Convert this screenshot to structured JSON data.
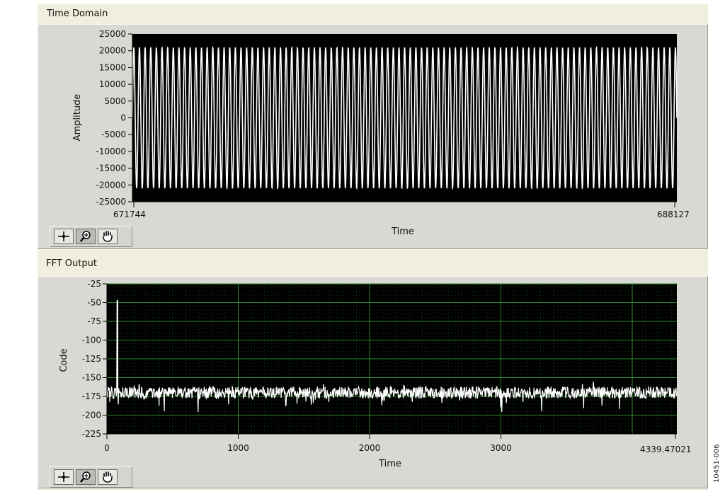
{
  "time_domain": {
    "title": "Time Domain",
    "xlabel": "Time",
    "ylabel": "Amplitude",
    "x_start_label": "671744",
    "x_end_label": "688127",
    "colors": {
      "plot_bg": "#000000",
      "trace": "#ffffff"
    },
    "y_ticks": [
      "25000",
      "20000",
      "15000",
      "10000",
      "5000",
      "0",
      "-5000",
      "-10000",
      "-15000",
      "-20000",
      "-25000"
    ]
  },
  "fft_output": {
    "title": "FFT Output",
    "xlabel": "Time",
    "ylabel": "Code",
    "x_ticks": [
      "0",
      "1000",
      "2000",
      "3000"
    ],
    "x_end_label": "4339.47021",
    "colors": {
      "plot_bg": "#000000",
      "trace": "#ffffff",
      "grid": "#2d8a2d"
    },
    "y_ticks": [
      "-25",
      "-50",
      "-75",
      "-100",
      "-125",
      "-150",
      "-175",
      "-200",
      "-225"
    ]
  },
  "figure_code": "10451-006",
  "chart_data": [
    {
      "type": "line",
      "title": "Time Domain",
      "xlabel": "Time",
      "ylabel": "Amplitude",
      "xlim": [
        671744,
        688127
      ],
      "ylim": [
        -25000,
        25000
      ],
      "y_ticks": [
        25000,
        20000,
        15000,
        10000,
        5000,
        0,
        -5000,
        -10000,
        -15000,
        -20000,
        -25000
      ],
      "x_tick_labels": [
        "671744",
        "688127"
      ],
      "amplitude": 21000,
      "grid": false
    },
    {
      "type": "line",
      "title": "FFT Output",
      "xlabel": "Time",
      "ylabel": "Code",
      "xlim": [
        0,
        4339.47021
      ],
      "ylim": [
        -225,
        -25
      ],
      "x_ticks": [
        0,
        1000,
        2000,
        3000
      ],
      "y_ticks": [
        -25,
        -50,
        -75,
        -100,
        -125,
        -150,
        -175,
        -200,
        -225
      ],
      "noise_floor": -170,
      "peak": {
        "x": 80,
        "y": -47
      },
      "grid": true
    }
  ]
}
